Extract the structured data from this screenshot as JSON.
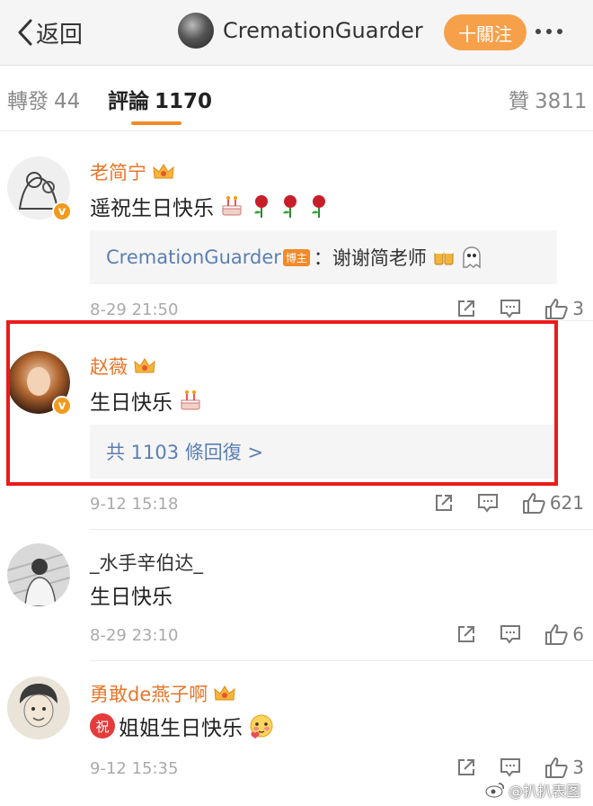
{
  "header": {
    "back_label": "返回",
    "username": "CremationGuarder",
    "follow_label": "十關注"
  },
  "tabs": [
    {
      "label": "轉發",
      "count": "44"
    },
    {
      "label": "評論",
      "count": "1170"
    },
    {
      "label": "贊",
      "count": "3811"
    }
  ],
  "active_tab": "評論",
  "comments": [
    {
      "author": "老简宁",
      "text": "遥祝生日快乐",
      "reply": {
        "author": "CremationGuarder",
        "badge": "博主",
        "text": "：谢谢简老师"
      },
      "time": "8-29 21:50",
      "likes": "3"
    },
    {
      "author": "赵薇",
      "text": "生日快乐",
      "reply_count_label": "共 1103 條回復 >",
      "time": "9-12 15:18",
      "likes": "621"
    },
    {
      "author": "_水手辛伯达_",
      "text": "生日快乐",
      "time": "8-29 23:10",
      "likes": "6"
    },
    {
      "author": "勇敢de燕子啊",
      "prefix_badge": "祝",
      "text": "姐姐生日快乐",
      "time": "9-12 15:35",
      "likes": "3"
    }
  ],
  "watermark": "@扒扒表图",
  "colors": {
    "accent": "#f28a2a",
    "link": "#5b7fb3",
    "highlight": "#ec1a1a"
  }
}
